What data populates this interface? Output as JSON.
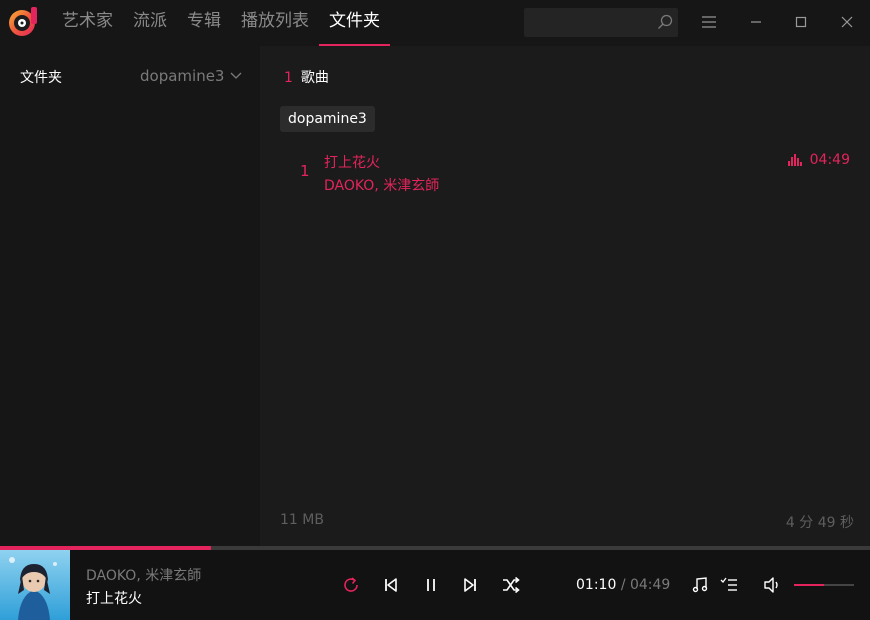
{
  "nav": {
    "tabs": [
      "艺术家",
      "流派",
      "专辑",
      "播放列表",
      "文件夹"
    ],
    "active_index": 4,
    "search_placeholder": ""
  },
  "sidebar": {
    "title": "文件夹",
    "selected_folder": "dopamine3"
  },
  "main": {
    "song_count": "1",
    "song_count_label": "歌曲",
    "folder_chip": "dopamine3",
    "tracks": [
      {
        "index": "1",
        "title": "打上花火",
        "artist": "DAOKO, 米津玄師",
        "duration": "04:49"
      }
    ],
    "footer_size": "11 MB",
    "footer_duration": "4 分 49 秒"
  },
  "player": {
    "artist": "DAOKO, 米津玄師",
    "title": "打上花火",
    "current_time": "01:10",
    "separator": "/",
    "total_time": "04:49",
    "progress_fraction": 0.242,
    "volume_fraction": 0.5
  },
  "colors": {
    "accent": "#e4245c",
    "background": "#181818",
    "text_muted": "#7a7a7a"
  },
  "icons": {
    "logo": "dopamine-logo-icon",
    "search": "search-icon",
    "menu": "hamburger-menu-icon",
    "minimize": "minimize-icon",
    "maximize": "maximize-icon",
    "close": "close-icon",
    "chevron": "chevron-down-icon",
    "playing": "equalizer-bars-icon",
    "loop": "loop-icon",
    "previous": "skip-previous-icon",
    "pause": "pause-icon",
    "next": "skip-next-icon",
    "shuffle": "shuffle-icon",
    "now_playing": "music-note-icon",
    "queue": "playlist-queue-icon",
    "volume": "volume-icon"
  }
}
